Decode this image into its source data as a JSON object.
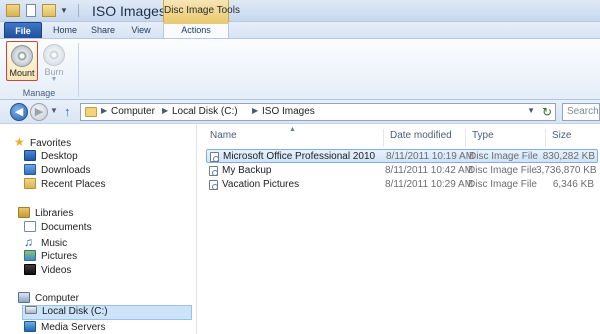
{
  "window": {
    "title": "ISO Images",
    "context_group": "Disc Image Tools"
  },
  "tabs": {
    "file": "File",
    "home": "Home",
    "share": "Share",
    "view": "View",
    "actions": "Actions"
  },
  "ribbon": {
    "mount_label": "Mount",
    "burn_label": "Burn",
    "group_label": "Manage"
  },
  "address": {
    "crumbs": [
      "Computer",
      "Local Disk (C:)",
      "ISO Images"
    ],
    "search_placeholder": "Search IS"
  },
  "nav": {
    "favorites": "Favorites",
    "desktop": "Desktop",
    "downloads": "Downloads",
    "recent_places": "Recent Places",
    "libraries": "Libraries",
    "documents": "Documents",
    "music": "Music",
    "pictures": "Pictures",
    "videos": "Videos",
    "computer": "Computer",
    "local_disk": "Local Disk (C:)",
    "media_servers": "Media Servers"
  },
  "columns": {
    "name": "Name",
    "date": "Date modified",
    "type": "Type",
    "size": "Size"
  },
  "files": [
    {
      "name": "Microsoft Office Professional 2010",
      "date": "8/11/2011 10:19 AM",
      "type": "Disc Image File",
      "size": "830,282 KB",
      "selected": true
    },
    {
      "name": "My Backup",
      "date": "8/11/2011 10:42 AM",
      "type": "Disc Image File",
      "size": "3,736,870 KB",
      "selected": false
    },
    {
      "name": "Vacation Pictures",
      "date": "8/11/2011 10:29 AM",
      "type": "Disc Image File",
      "size": "6,346 KB",
      "selected": false
    }
  ],
  "colors": {
    "file_tab": "#2a5fb0",
    "context_accent": "#eacb72",
    "selection": "#cde3f9"
  }
}
